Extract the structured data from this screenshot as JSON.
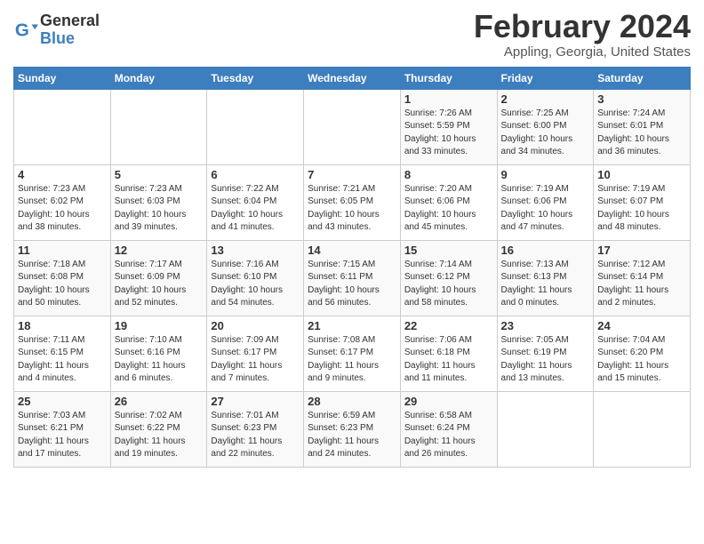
{
  "logo": {
    "general": "General",
    "blue": "Blue"
  },
  "title": "February 2024",
  "subtitle": "Appling, Georgia, United States",
  "weekdays": [
    "Sunday",
    "Monday",
    "Tuesday",
    "Wednesday",
    "Thursday",
    "Friday",
    "Saturday"
  ],
  "weeks": [
    [
      {
        "day": "",
        "info": ""
      },
      {
        "day": "",
        "info": ""
      },
      {
        "day": "",
        "info": ""
      },
      {
        "day": "",
        "info": ""
      },
      {
        "day": "1",
        "info": "Sunrise: 7:26 AM\nSunset: 5:59 PM\nDaylight: 10 hours\nand 33 minutes."
      },
      {
        "day": "2",
        "info": "Sunrise: 7:25 AM\nSunset: 6:00 PM\nDaylight: 10 hours\nand 34 minutes."
      },
      {
        "day": "3",
        "info": "Sunrise: 7:24 AM\nSunset: 6:01 PM\nDaylight: 10 hours\nand 36 minutes."
      }
    ],
    [
      {
        "day": "4",
        "info": "Sunrise: 7:23 AM\nSunset: 6:02 PM\nDaylight: 10 hours\nand 38 minutes."
      },
      {
        "day": "5",
        "info": "Sunrise: 7:23 AM\nSunset: 6:03 PM\nDaylight: 10 hours\nand 39 minutes."
      },
      {
        "day": "6",
        "info": "Sunrise: 7:22 AM\nSunset: 6:04 PM\nDaylight: 10 hours\nand 41 minutes."
      },
      {
        "day": "7",
        "info": "Sunrise: 7:21 AM\nSunset: 6:05 PM\nDaylight: 10 hours\nand 43 minutes."
      },
      {
        "day": "8",
        "info": "Sunrise: 7:20 AM\nSunset: 6:06 PM\nDaylight: 10 hours\nand 45 minutes."
      },
      {
        "day": "9",
        "info": "Sunrise: 7:19 AM\nSunset: 6:06 PM\nDaylight: 10 hours\nand 47 minutes."
      },
      {
        "day": "10",
        "info": "Sunrise: 7:19 AM\nSunset: 6:07 PM\nDaylight: 10 hours\nand 48 minutes."
      }
    ],
    [
      {
        "day": "11",
        "info": "Sunrise: 7:18 AM\nSunset: 6:08 PM\nDaylight: 10 hours\nand 50 minutes."
      },
      {
        "day": "12",
        "info": "Sunrise: 7:17 AM\nSunset: 6:09 PM\nDaylight: 10 hours\nand 52 minutes."
      },
      {
        "day": "13",
        "info": "Sunrise: 7:16 AM\nSunset: 6:10 PM\nDaylight: 10 hours\nand 54 minutes."
      },
      {
        "day": "14",
        "info": "Sunrise: 7:15 AM\nSunset: 6:11 PM\nDaylight: 10 hours\nand 56 minutes."
      },
      {
        "day": "15",
        "info": "Sunrise: 7:14 AM\nSunset: 6:12 PM\nDaylight: 10 hours\nand 58 minutes."
      },
      {
        "day": "16",
        "info": "Sunrise: 7:13 AM\nSunset: 6:13 PM\nDaylight: 11 hours\nand 0 minutes."
      },
      {
        "day": "17",
        "info": "Sunrise: 7:12 AM\nSunset: 6:14 PM\nDaylight: 11 hours\nand 2 minutes."
      }
    ],
    [
      {
        "day": "18",
        "info": "Sunrise: 7:11 AM\nSunset: 6:15 PM\nDaylight: 11 hours\nand 4 minutes."
      },
      {
        "day": "19",
        "info": "Sunrise: 7:10 AM\nSunset: 6:16 PM\nDaylight: 11 hours\nand 6 minutes."
      },
      {
        "day": "20",
        "info": "Sunrise: 7:09 AM\nSunset: 6:17 PM\nDaylight: 11 hours\nand 7 minutes."
      },
      {
        "day": "21",
        "info": "Sunrise: 7:08 AM\nSunset: 6:17 PM\nDaylight: 11 hours\nand 9 minutes."
      },
      {
        "day": "22",
        "info": "Sunrise: 7:06 AM\nSunset: 6:18 PM\nDaylight: 11 hours\nand 11 minutes."
      },
      {
        "day": "23",
        "info": "Sunrise: 7:05 AM\nSunset: 6:19 PM\nDaylight: 11 hours\nand 13 minutes."
      },
      {
        "day": "24",
        "info": "Sunrise: 7:04 AM\nSunset: 6:20 PM\nDaylight: 11 hours\nand 15 minutes."
      }
    ],
    [
      {
        "day": "25",
        "info": "Sunrise: 7:03 AM\nSunset: 6:21 PM\nDaylight: 11 hours\nand 17 minutes."
      },
      {
        "day": "26",
        "info": "Sunrise: 7:02 AM\nSunset: 6:22 PM\nDaylight: 11 hours\nand 19 minutes."
      },
      {
        "day": "27",
        "info": "Sunrise: 7:01 AM\nSunset: 6:23 PM\nDaylight: 11 hours\nand 22 minutes."
      },
      {
        "day": "28",
        "info": "Sunrise: 6:59 AM\nSunset: 6:23 PM\nDaylight: 11 hours\nand 24 minutes."
      },
      {
        "day": "29",
        "info": "Sunrise: 6:58 AM\nSunset: 6:24 PM\nDaylight: 11 hours\nand 26 minutes."
      },
      {
        "day": "",
        "info": ""
      },
      {
        "day": "",
        "info": ""
      }
    ]
  ]
}
